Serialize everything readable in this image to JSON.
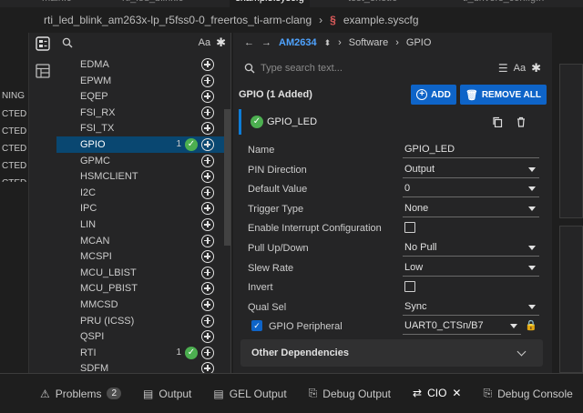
{
  "tabs": [
    {
      "label": "main.c",
      "active": false
    },
    {
      "label": "rti_led_blink.c",
      "active": false
    },
    {
      "label": "example.syscfg",
      "active": true
    },
    {
      "label": "test_enet.c",
      "active": false
    },
    {
      "label": "ti_drivers_config.h",
      "active": false
    }
  ],
  "breadcrumb": {
    "project": "rti_led_blink_am263x-lp_r5fss0-0_freertos_ti-arm-clang",
    "file": "example.syscfg"
  },
  "left_strip": [
    {
      "text": "NING",
      "selected": true
    },
    {
      "text": "CTED",
      "selected": false
    },
    {
      "text": "CTED",
      "selected": false
    },
    {
      "text": "CTED",
      "selected": false
    },
    {
      "text": "CTED",
      "selected": false
    },
    {
      "text": "CTED",
      "selected": false
    }
  ],
  "module_panel": {
    "search_case": "Aa",
    "modules": [
      {
        "label": "EDMA",
        "count": "",
        "checked": false,
        "selected": false
      },
      {
        "label": "EPWM",
        "count": "",
        "checked": false,
        "selected": false
      },
      {
        "label": "EQEP",
        "count": "",
        "checked": false,
        "selected": false
      },
      {
        "label": "FSI_RX",
        "count": "",
        "checked": false,
        "selected": false
      },
      {
        "label": "FSI_TX",
        "count": "",
        "checked": false,
        "selected": false
      },
      {
        "label": "GPIO",
        "count": "1",
        "checked": true,
        "selected": true
      },
      {
        "label": "GPMC",
        "count": "",
        "checked": false,
        "selected": false
      },
      {
        "label": "HSMCLIENT",
        "count": "",
        "checked": false,
        "selected": false
      },
      {
        "label": "I2C",
        "count": "",
        "checked": false,
        "selected": false
      },
      {
        "label": "IPC",
        "count": "",
        "checked": false,
        "selected": false
      },
      {
        "label": "LIN",
        "count": "",
        "checked": false,
        "selected": false
      },
      {
        "label": "MCAN",
        "count": "",
        "checked": false,
        "selected": false
      },
      {
        "label": "MCSPI",
        "count": "",
        "checked": false,
        "selected": false
      },
      {
        "label": "MCU_LBIST",
        "count": "",
        "checked": false,
        "selected": false
      },
      {
        "label": "MCU_PBIST",
        "count": "",
        "checked": false,
        "selected": false
      },
      {
        "label": "MMCSD",
        "count": "",
        "checked": false,
        "selected": false
      },
      {
        "label": "PRU (ICSS)",
        "count": "",
        "checked": false,
        "selected": false
      },
      {
        "label": "QSPI",
        "count": "",
        "checked": false,
        "selected": false
      },
      {
        "label": "RTI",
        "count": "1",
        "checked": true,
        "selected": false
      },
      {
        "label": "SDFM",
        "count": "",
        "checked": false,
        "selected": false
      }
    ]
  },
  "main": {
    "device": "AM2634",
    "crumb_software": "Software",
    "crumb_module": "GPIO",
    "search_placeholder": "Type search text...",
    "search_case": "Aa",
    "header_title": "GPIO (1 Added)",
    "add_label": "ADD",
    "remove_all_label": "REMOVE ALL",
    "instance_name": "GPIO_LED",
    "properties": [
      {
        "label": "Name",
        "value": "GPIO_LED",
        "kind": "text"
      },
      {
        "label": "PIN Direction",
        "value": "Output",
        "kind": "select"
      },
      {
        "label": "Default Value",
        "value": "0",
        "kind": "select"
      },
      {
        "label": "Trigger Type",
        "value": "None",
        "kind": "select"
      },
      {
        "label": "Enable Interrupt Configuration",
        "value": "",
        "kind": "checkbox"
      },
      {
        "label": "Pull Up/Down",
        "value": "No Pull",
        "kind": "select"
      },
      {
        "label": "Slew Rate",
        "value": "Low",
        "kind": "select"
      },
      {
        "label": "Invert",
        "value": "",
        "kind": "checkbox"
      },
      {
        "label": "Qual Sel",
        "value": "Sync",
        "kind": "select"
      },
      {
        "label": "GPIO Peripheral",
        "value": "UART0_CTSn/B7",
        "kind": "peripheral"
      }
    ],
    "other_dependencies": "Other Dependencies"
  },
  "bottom_tabs": [
    {
      "label": "Problems",
      "badge": "2",
      "active": false
    },
    {
      "label": "Output",
      "badge": "",
      "active": false
    },
    {
      "label": "GEL Output",
      "badge": "",
      "active": false
    },
    {
      "label": "Debug Output",
      "badge": "",
      "active": false
    },
    {
      "label": "CIO",
      "badge": "",
      "active": true
    },
    {
      "label": "Debug Console",
      "badge": "",
      "active": false
    }
  ],
  "colors": {
    "accent": "#0e64c8",
    "selection": "#094771",
    "check": "#4caf50",
    "syscfg": "#e05c5c"
  }
}
